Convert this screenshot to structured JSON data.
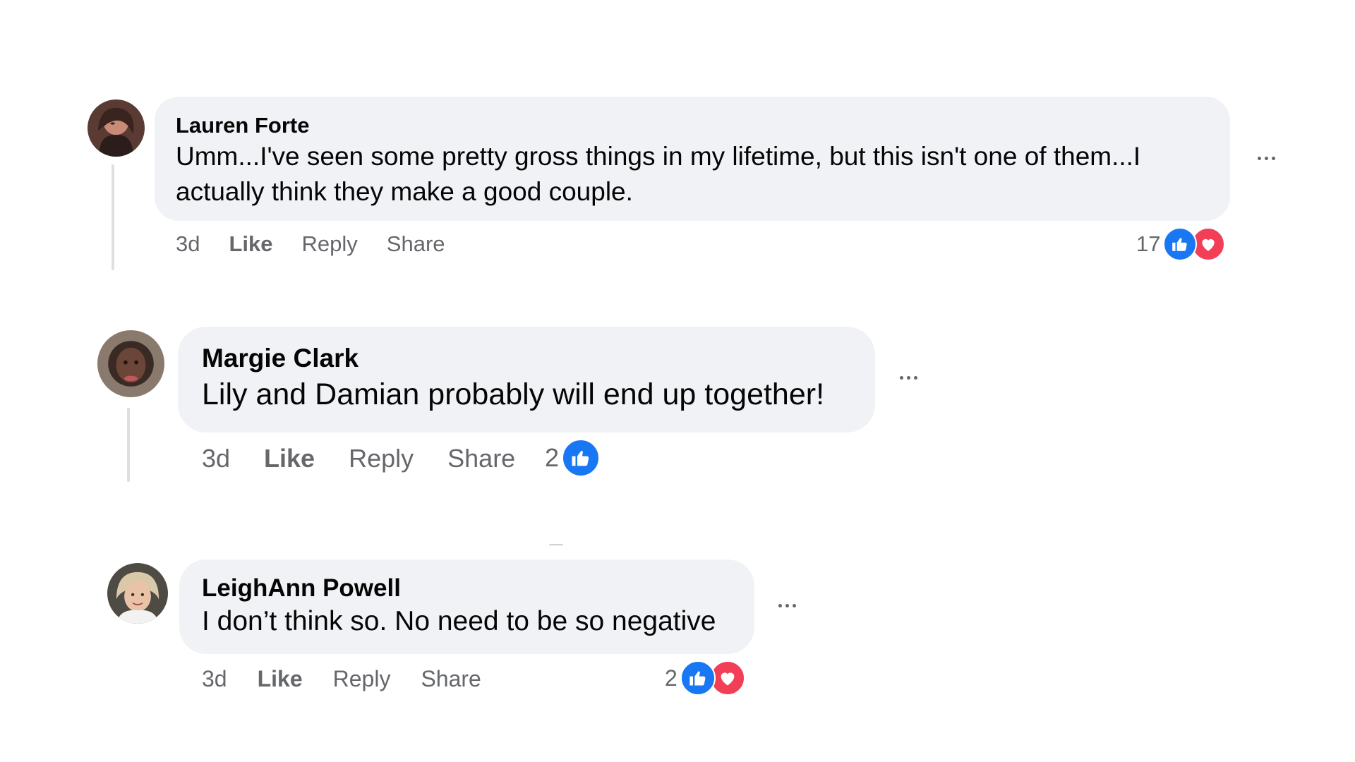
{
  "comments": [
    {
      "author": "Lauren Forte",
      "text_lines": [
        "Umm...I've seen some pretty gross things in my lifetime, but this isn't one of them...I",
        "actually think they make a good couple."
      ],
      "time": "3d",
      "like_label": "Like",
      "reply_label": "Reply",
      "share_label": "Share",
      "reaction_count": "17",
      "reactions": [
        "like-icon",
        "love-icon"
      ]
    },
    {
      "author": "Margie Clark",
      "text_lines": [
        "Lily and Damian probably will end up together!"
      ],
      "time": "3d",
      "like_label": "Like",
      "reply_label": "Reply",
      "share_label": "Share",
      "reaction_count": "2",
      "reactions": [
        "like-icon"
      ]
    },
    {
      "author": "LeighAnn Powell",
      "text_lines": [
        "I don’t think so. No need to be so negative"
      ],
      "time": "3d",
      "like_label": "Like",
      "reply_label": "Reply",
      "share_label": "Share",
      "reaction_count": "2",
      "reactions": [
        "like-icon",
        "love-icon"
      ]
    }
  ],
  "colors": {
    "bubble_bg": "#f0f2f5",
    "secondary_text": "#65676b",
    "like_blue": "#1877f2",
    "love_red": "#f33e58",
    "thread_line": "#dddfe2"
  }
}
